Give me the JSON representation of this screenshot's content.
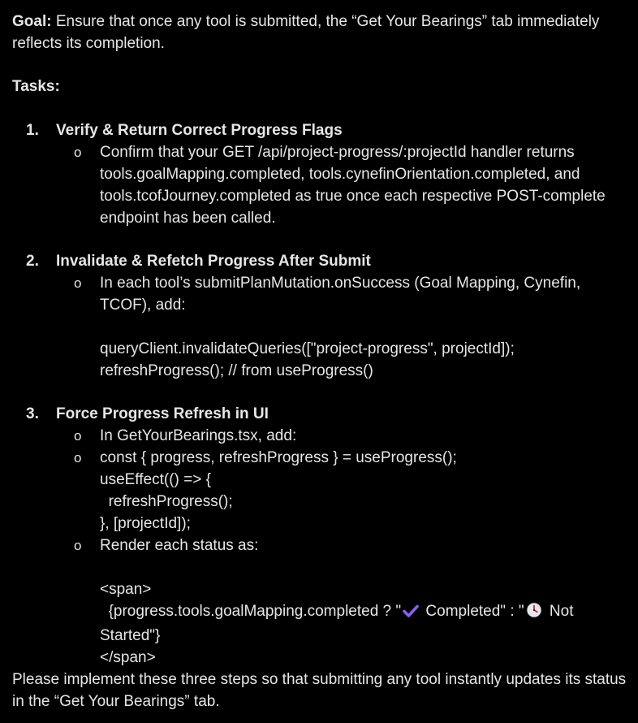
{
  "goal": {
    "label": "Goal:",
    "text": "Ensure that once any tool is submitted, the “Get Your Bearings” tab immediately reflects its completion."
  },
  "tasks_heading": "Tasks:",
  "tasks": [
    {
      "number": "1.",
      "title": "Verify & Return Correct Progress Flags",
      "bullets": [
        {
          "mark": "o",
          "lines": [
            "Confirm that your GET /api/project-progress/:projectId handler returns tools.goalMapping.completed, tools.cynefinOrientation.completed, and tools.tcofJourney.completed as true once each respective POST-complete endpoint has been called."
          ]
        }
      ]
    },
    {
      "number": "2.",
      "title": "Invalidate & Refetch Progress After Submit",
      "bullets": [
        {
          "mark": "o",
          "lines": [
            "In each tool’s submitPlanMutation.onSuccess (Goal Mapping, Cynefin, TCOF), add:",
            "",
            "queryClient.invalidateQueries([\"project-progress\", projectId]);",
            "refreshProgress(); // from useProgress()"
          ]
        }
      ]
    },
    {
      "number": "3.",
      "title": "Force Progress Refresh in UI",
      "bullets": [
        {
          "mark": "o",
          "lines": [
            "In GetYourBearings.tsx, add:"
          ]
        },
        {
          "mark": "o",
          "lines": [
            "const { progress, refreshProgress } = useProgress();",
            "useEffect(() => {",
            "  refreshProgress();",
            "}, [projectId]);"
          ]
        },
        {
          "mark": "o",
          "lines": [
            "Render each status as:",
            "",
            "<span>"
          ],
          "expr_start": "  {progress.tools.goalMapping.completed ? \"",
          "check_icon": "check-icon",
          "check_color": "#8b5cf6",
          "expr_mid": " Completed\" : \"",
          "clock_icon": "clock-icon",
          "clock_color": "#e5e7eb",
          "expr_end": " Not Started\"}",
          "close_tag": "</span>"
        }
      ]
    }
  ],
  "closing": "Please implement these three steps so that submitting any tool instantly updates its status in the “Get Your Bearings” tab."
}
